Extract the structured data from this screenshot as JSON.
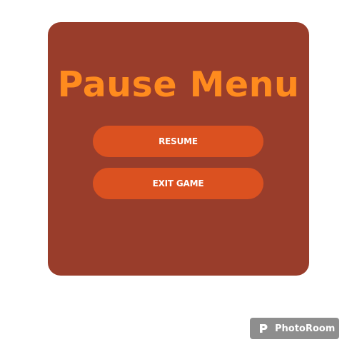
{
  "pause_menu": {
    "title": "Pause Menu",
    "buttons": {
      "resume": "RESUME",
      "exit": "EXIT GAME"
    }
  },
  "watermark": {
    "text": "PhotoRoom",
    "icon": "photoroom-logo-icon"
  },
  "colors": {
    "background": "#ffffff",
    "panel": "#993d2b",
    "title": "#ff8b1e",
    "button": "#db5120",
    "button_text": "#ffffff",
    "watermark_bg": "#8e8e8e"
  }
}
